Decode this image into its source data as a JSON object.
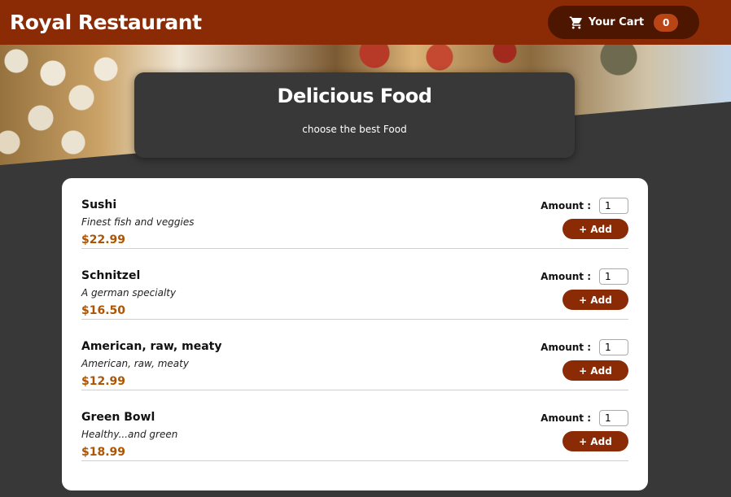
{
  "header": {
    "brand": "Royal Restaurant",
    "cart_label": "Your Cart",
    "cart_count": "0"
  },
  "hero": {
    "title": "Delicious Food",
    "subtitle": "choose the best Food"
  },
  "amount_label": "Amount :",
  "add_label": "+ Add",
  "meals": [
    {
      "name": "Sushi",
      "description": "Finest fish and veggies",
      "price": "$22.99",
      "amount": "1"
    },
    {
      "name": "Schnitzel",
      "description": "A german specialty",
      "price": "$16.50",
      "amount": "1"
    },
    {
      "name": "American, raw, meaty",
      "description": "American, raw, meaty",
      "price": "$12.99",
      "amount": "1"
    },
    {
      "name": "Green Bowl",
      "description": "Healthy...and green",
      "price": "$18.99",
      "amount": "1"
    }
  ],
  "colors": {
    "header": "#8a2b06",
    "cart_button": "#4d1601",
    "badge": "#b94517",
    "price": "#ad5502",
    "background": "#383838"
  }
}
